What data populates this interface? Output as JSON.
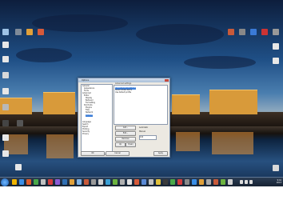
{
  "dialog": {
    "title": "Options",
    "tree_items": [
      "General",
      "Appearance",
      "Fonts",
      "Advanced",
      "Editor",
      "Display",
      "Behavior",
      "Formatting",
      "Shortcuts",
      "Plugins",
      "Files",
      "Network",
      "Updates",
      "Language",
      "Search",
      "Export",
      "Printing",
      "Security",
      "Privacy"
    ],
    "group_title": "Advanced settings",
    "list_rows": [
      "Enable advanced mode",
      "Show hidden items",
      "Use default profile"
    ],
    "buttons": {
      "add": "Add...",
      "edit": "Edit...",
      "remove": "Remove",
      "up": "Up",
      "down": "Down",
      "ok": "OK",
      "cancel": "Cancel",
      "apply": "Apply"
    },
    "options": [
      "Automatic",
      "Manual"
    ],
    "field_value": "100"
  },
  "taskbar": {
    "time": "9:41",
    "date": "2013"
  }
}
